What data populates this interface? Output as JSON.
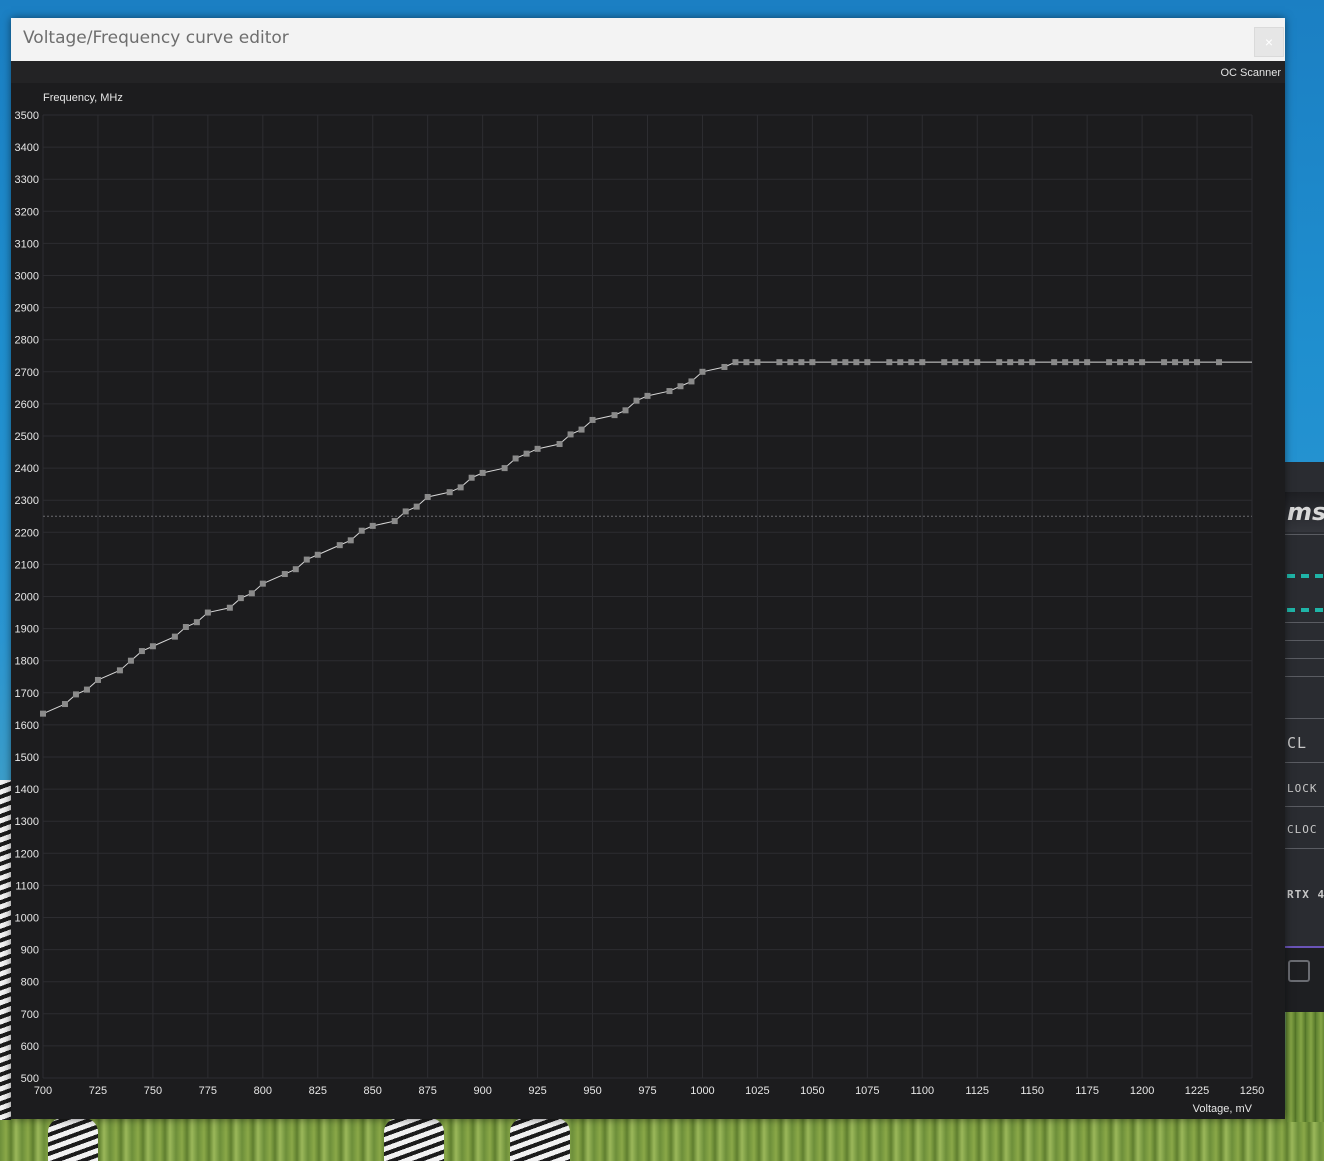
{
  "window": {
    "title": "Voltage/Frequency curve editor",
    "close_label": "×"
  },
  "toolbar": {
    "oc_scanner_label": "OC Scanner"
  },
  "background_app": {
    "logo_text": "msi",
    "label_clock_big": "CL",
    "label_clock_1": "LOCK",
    "label_clock_2": "CLOC",
    "gpu_label": "RTX 4"
  },
  "colors": {
    "chart_background": "#1c1c1e",
    "grid": "#2d2d31",
    "curve": "#d8d8d8",
    "point": "#8a8a8a",
    "accent_teal": "#1fb5a8"
  },
  "chart_data": {
    "type": "line",
    "xlabel": "Voltage, mV",
    "ylabel": "Frequency, MHz",
    "xlim": [
      700,
      1250
    ],
    "ylim": [
      500,
      3500
    ],
    "x_ticks": [
      700,
      725,
      750,
      775,
      800,
      825,
      850,
      875,
      900,
      925,
      950,
      975,
      1000,
      1025,
      1050,
      1075,
      1100,
      1125,
      1150,
      1175,
      1200,
      1225,
      1250
    ],
    "y_ticks": [
      500,
      600,
      700,
      800,
      900,
      1000,
      1100,
      1200,
      1300,
      1400,
      1500,
      1600,
      1700,
      1800,
      1900,
      2000,
      2100,
      2200,
      2300,
      2400,
      2500,
      2600,
      2700,
      2800,
      2900,
      3000,
      3100,
      3200,
      3300,
      3400,
      3500
    ],
    "grid": true,
    "reference_line_y": 2250,
    "series": [
      {
        "points": [
          [
            700,
            1635
          ],
          [
            710,
            1665
          ],
          [
            715,
            1695
          ],
          [
            720,
            1710
          ],
          [
            725,
            1740
          ],
          [
            735,
            1770
          ],
          [
            740,
            1800
          ],
          [
            745,
            1830
          ],
          [
            750,
            1845
          ],
          [
            760,
            1875
          ],
          [
            765,
            1905
          ],
          [
            770,
            1920
          ],
          [
            775,
            1950
          ],
          [
            785,
            1965
          ],
          [
            790,
            1995
          ],
          [
            795,
            2010
          ],
          [
            800,
            2040
          ],
          [
            810,
            2070
          ],
          [
            815,
            2085
          ],
          [
            820,
            2115
          ],
          [
            825,
            2130
          ],
          [
            835,
            2160
          ],
          [
            840,
            2175
          ],
          [
            845,
            2205
          ],
          [
            850,
            2220
          ],
          [
            860,
            2235
          ],
          [
            865,
            2265
          ],
          [
            870,
            2280
          ],
          [
            875,
            2310
          ],
          [
            885,
            2325
          ],
          [
            890,
            2340
          ],
          [
            895,
            2370
          ],
          [
            900,
            2385
          ],
          [
            910,
            2400
          ],
          [
            915,
            2430
          ],
          [
            920,
            2445
          ],
          [
            925,
            2460
          ],
          [
            935,
            2475
          ],
          [
            940,
            2505
          ],
          [
            945,
            2520
          ],
          [
            950,
            2550
          ],
          [
            960,
            2565
          ],
          [
            965,
            2580
          ],
          [
            970,
            2610
          ],
          [
            975,
            2625
          ],
          [
            985,
            2640
          ],
          [
            990,
            2655
          ],
          [
            995,
            2670
          ],
          [
            1000,
            2700
          ],
          [
            1010,
            2715
          ],
          [
            1015,
            2730
          ],
          [
            1020,
            2730
          ],
          [
            1025,
            2730
          ],
          [
            1035,
            2730
          ],
          [
            1040,
            2730
          ],
          [
            1045,
            2730
          ],
          [
            1050,
            2730
          ],
          [
            1060,
            2730
          ],
          [
            1065,
            2730
          ],
          [
            1070,
            2730
          ],
          [
            1075,
            2730
          ],
          [
            1085,
            2730
          ],
          [
            1090,
            2730
          ],
          [
            1095,
            2730
          ],
          [
            1100,
            2730
          ],
          [
            1110,
            2730
          ],
          [
            1115,
            2730
          ],
          [
            1120,
            2730
          ],
          [
            1125,
            2730
          ],
          [
            1135,
            2730
          ],
          [
            1140,
            2730
          ],
          [
            1145,
            2730
          ],
          [
            1150,
            2730
          ],
          [
            1160,
            2730
          ],
          [
            1165,
            2730
          ],
          [
            1170,
            2730
          ],
          [
            1175,
            2730
          ],
          [
            1185,
            2730
          ],
          [
            1190,
            2730
          ],
          [
            1195,
            2730
          ],
          [
            1200,
            2730
          ],
          [
            1210,
            2730
          ],
          [
            1215,
            2730
          ],
          [
            1220,
            2730
          ],
          [
            1225,
            2730
          ],
          [
            1235,
            2730
          ],
          [
            1250,
            2730
          ]
        ]
      }
    ]
  }
}
